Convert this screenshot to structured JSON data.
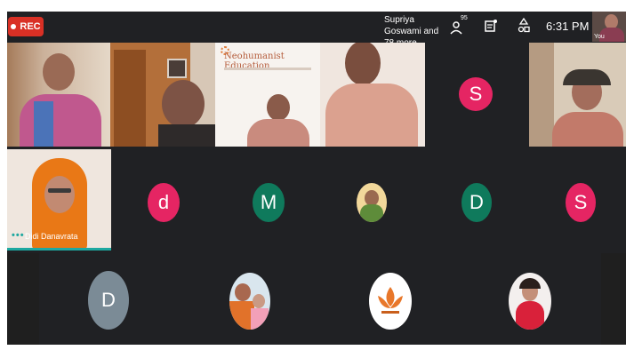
{
  "recording": {
    "label": "REC"
  },
  "presenting": {
    "text": "Supriya Goswami and 78 more"
  },
  "controls": {
    "participant_count": "95",
    "people_icon": "people-icon",
    "chat_icon": "chat-icon",
    "activities_icon": "activities-icon"
  },
  "clock": "6:31 PM",
  "self_view": {
    "label": "You"
  },
  "slide": {
    "title": "Neohumanist Education"
  },
  "tiles": {
    "didi": {
      "name": "Didi Danavrata"
    }
  },
  "avatars": [
    {
      "letter": "S",
      "color": "#e52563"
    },
    {
      "letter": "d",
      "color": "#e52563"
    },
    {
      "letter": "M",
      "color": "#0f7a5c"
    },
    {
      "letter": "D",
      "color": "#0f7a5c"
    },
    {
      "letter": "S",
      "color": "#e52563"
    },
    {
      "letter": "D",
      "color": "#7b8b96"
    }
  ],
  "colors": {
    "background": "#202124",
    "active_speaker": "#1ea8a0",
    "rec": "#d93025"
  }
}
